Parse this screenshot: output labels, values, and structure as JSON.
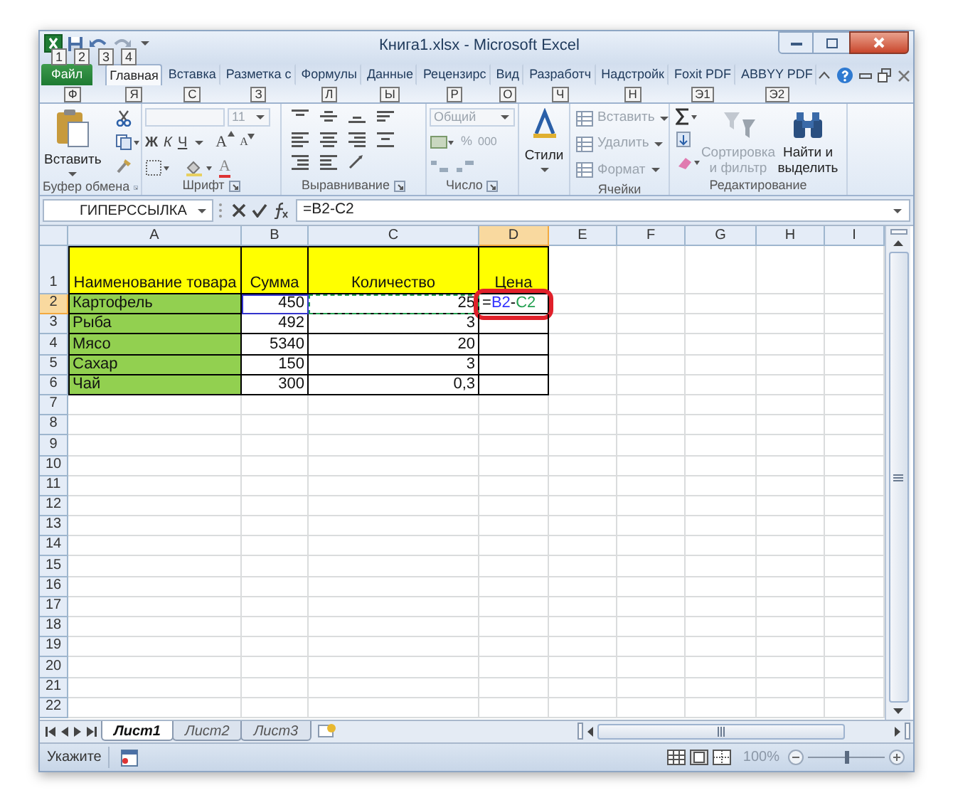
{
  "window": {
    "title": "Книга1.xlsx - Microsoft Excel"
  },
  "quick_access_keytips": [
    "1",
    "2",
    "3",
    "4"
  ],
  "tabs": [
    {
      "label": "Файл",
      "keytip": "Ф",
      "kind": "file",
      "selected": false
    },
    {
      "label": "Главная",
      "keytip": "Я",
      "kind": "tab",
      "selected": true
    },
    {
      "label": "Вставка",
      "keytip": "С",
      "kind": "tab",
      "selected": false
    },
    {
      "label": "Разметка с",
      "keytip": "З",
      "kind": "tab",
      "selected": false
    },
    {
      "label": "Формулы",
      "keytip": "Л",
      "kind": "tab",
      "selected": false
    },
    {
      "label": "Данные",
      "keytip": "Ы",
      "kind": "tab",
      "selected": false
    },
    {
      "label": "Рецензирс",
      "keytip": "Р",
      "kind": "tab",
      "selected": false
    },
    {
      "label": "Вид",
      "keytip": "О",
      "kind": "tab",
      "selected": false
    },
    {
      "label": "Разработч",
      "keytip": "Ч",
      "kind": "tab",
      "selected": false
    },
    {
      "label": "Надстройк",
      "keytip": "Н",
      "kind": "tab",
      "selected": false
    },
    {
      "label": "Foxit PDF",
      "keytip": "Э1",
      "kind": "tab",
      "selected": false
    },
    {
      "label": "ABBYY PDF",
      "keytip": "Э2",
      "kind": "tab",
      "selected": false
    }
  ],
  "ribbon": [
    {
      "kind": "clipboard",
      "label": "Буфер обмена",
      "paste": "Вставить",
      "launcher": true
    },
    {
      "kind": "font",
      "label": "Шрифт",
      "size": "11",
      "bold": "Ж",
      "italic": "К",
      "underline": "Ч",
      "grow": "A",
      "shrink": "A",
      "color_button": "A",
      "launcher": true
    },
    {
      "kind": "alignment",
      "label": "Выравнивание",
      "launcher": true
    },
    {
      "kind": "number",
      "label": "Число",
      "format": "Общий",
      "percent": "%",
      "thousands": "000",
      "launcher": true
    },
    {
      "kind": "styles",
      "button": "Стили"
    },
    {
      "kind": "cells",
      "label": "Ячейки",
      "buttons": [
        {
          "label": "Вставить",
          "disabled": true
        },
        {
          "label": "Удалить",
          "disabled": true
        },
        {
          "label": "Формат",
          "disabled": true
        }
      ]
    },
    {
      "kind": "editing",
      "label": "Редактирование",
      "sort": {
        "label": "Сортировка и фильтр",
        "disabled": true
      },
      "find": {
        "label": "Найти и выделить",
        "disabled": false
      }
    }
  ],
  "formula_bar": {
    "name_box": "ГИПЕРССЫЛКА",
    "formula": "=B2-C2"
  },
  "columns": [
    {
      "label": "A",
      "selected": false
    },
    {
      "label": "B",
      "selected": false
    },
    {
      "label": "C",
      "selected": false
    },
    {
      "label": "D",
      "selected": true
    },
    {
      "label": "E",
      "selected": false
    },
    {
      "label": "F",
      "selected": false
    },
    {
      "label": "G",
      "selected": false
    },
    {
      "label": "H",
      "selected": false
    },
    {
      "label": "I",
      "selected": false
    }
  ],
  "rows": [
    {
      "number": "1",
      "selected": false,
      "cells": [
        {
          "kind": "text",
          "text": "Наименование товара",
          "color": "#ffff00"
        },
        {
          "kind": "text",
          "text": "Сумма",
          "color": "#ffff00"
        },
        {
          "kind": "text",
          "text": "Количество",
          "color": "#ffff00"
        },
        {
          "kind": "text",
          "text": "Цена",
          "color": "#ffff00"
        }
      ]
    },
    {
      "number": "2",
      "selected": true,
      "cells": [
        {
          "kind": "text",
          "text": "Картофель",
          "color": "#92d050"
        },
        {
          "kind": "text",
          "text": "450",
          "ref": {
            "color": "#3333cc",
            "dashed": false
          }
        },
        {
          "kind": "text",
          "text": "25",
          "ref": {
            "color": "#22a050",
            "dashed": true
          }
        },
        {
          "kind": "formula",
          "parts": [
            {
              "text": "=",
              "color": "#000000"
            },
            {
              "text": "B2",
              "color": "#3333ff"
            },
            {
              "text": "-",
              "color": "#000000"
            },
            {
              "text": "C2",
              "color": "#22a050"
            }
          ],
          "circled": true
        }
      ]
    },
    {
      "number": "3",
      "selected": false,
      "cells": [
        {
          "kind": "text",
          "text": "Рыба",
          "color": "#92d050"
        },
        {
          "kind": "text",
          "text": "492"
        },
        {
          "kind": "text",
          "text": "3"
        },
        {
          "kind": "blank"
        }
      ]
    },
    {
      "number": "4",
      "selected": false,
      "cells": [
        {
          "kind": "text",
          "text": "Мясо",
          "color": "#92d050"
        },
        {
          "kind": "text",
          "text": "5340"
        },
        {
          "kind": "text",
          "text": "20"
        },
        {
          "kind": "blank"
        }
      ]
    },
    {
      "number": "5",
      "selected": false,
      "cells": [
        {
          "kind": "text",
          "text": "Сахар",
          "color": "#92d050"
        },
        {
          "kind": "text",
          "text": "150"
        },
        {
          "kind": "text",
          "text": "3"
        },
        {
          "kind": "blank"
        }
      ]
    },
    {
      "number": "6",
      "selected": false,
      "cells": [
        {
          "kind": "text",
          "text": "Чай",
          "color": "#92d050"
        },
        {
          "kind": "text",
          "text": "300"
        },
        {
          "kind": "text",
          "text": "0,3"
        },
        {
          "kind": "blank"
        }
      ]
    },
    {
      "number": "7",
      "selected": false
    },
    {
      "number": "8",
      "selected": false
    },
    {
      "number": "9",
      "selected": false
    },
    {
      "number": "10",
      "selected": false
    },
    {
      "number": "11",
      "selected": false
    },
    {
      "number": "12",
      "selected": false
    },
    {
      "number": "13",
      "selected": false
    },
    {
      "number": "14",
      "selected": false
    },
    {
      "number": "15",
      "selected": false
    },
    {
      "number": "16",
      "selected": false
    },
    {
      "number": "17",
      "selected": false
    },
    {
      "number": "18",
      "selected": false
    },
    {
      "number": "19",
      "selected": false
    },
    {
      "number": "20",
      "selected": false
    },
    {
      "number": "21",
      "selected": false
    },
    {
      "number": "22",
      "selected": false
    }
  ],
  "sheets": [
    {
      "label": "Лист1",
      "selected": true
    },
    {
      "label": "Лист2",
      "selected": false
    },
    {
      "label": "Лист3",
      "selected": false
    }
  ],
  "status_bar": {
    "mode": "Укажите",
    "zoom": {
      "reading": "100%",
      "level": 0.5
    }
  }
}
